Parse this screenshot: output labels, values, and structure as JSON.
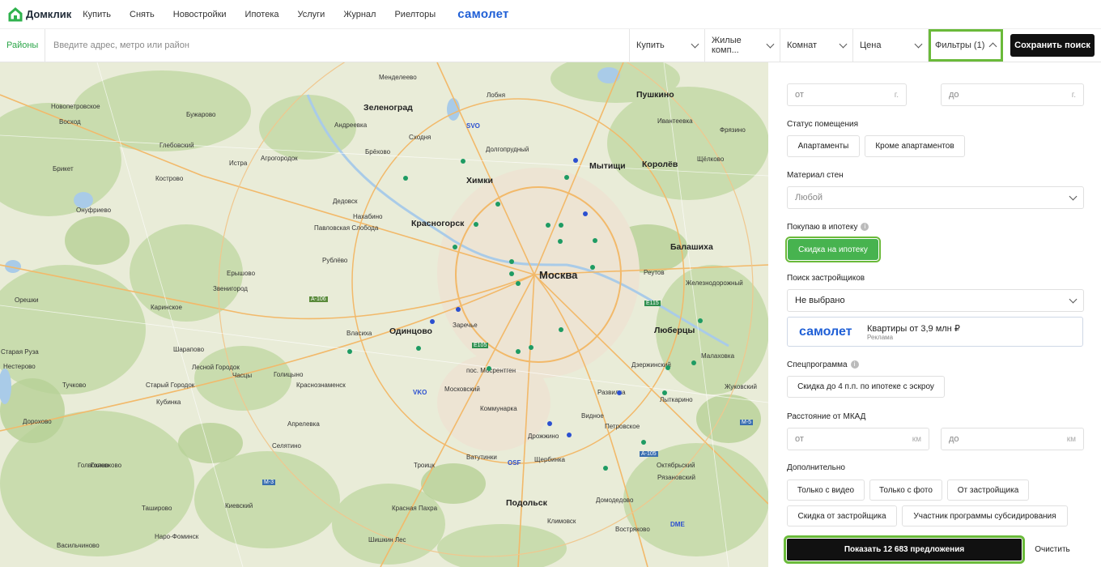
{
  "header": {
    "logo": "Домклик",
    "nav": [
      "Купить",
      "Снять",
      "Новостройки",
      "Ипотека",
      "Услуги",
      "Журнал",
      "Риелторы"
    ],
    "brand": "самолет"
  },
  "search": {
    "districts": "Районы",
    "placeholder": "Введите адрес, метро или район",
    "deal_type": "Купить",
    "property_type": "Жилые комп...",
    "rooms": "Комнат",
    "price": "Цена",
    "filters": "Фильтры (1)",
    "save": "Сохранить поиск"
  },
  "map": {
    "big_labels": [
      "Москва"
    ],
    "city_labels": [
      "Зеленоград",
      "Химки",
      "Мытищи",
      "Королёв",
      "Красногорск",
      "Балашиха",
      "Одинцово",
      "Люберцы",
      "Подольск",
      "Пушкино"
    ],
    "labels": [
      "Менделеево",
      "Лобня",
      "Андреевка",
      "Сходня",
      "Долгопрудный",
      "Ивантеевка",
      "Фрязино",
      "Щёлково",
      "Истра",
      "Дедовск",
      "Нахабино",
      "Павловская Слобода",
      "Новопетровское",
      "Бужарово",
      "Восход",
      "Глебовский",
      "Агрогородок",
      "Брёхово",
      "Брикет",
      "Кострово",
      "Онуфриево",
      "Рублёво",
      "Ерышово",
      "Звенигород",
      "Власиха",
      "Заречье",
      "Реутов",
      "Железнодорожный",
      "Голицыно",
      "Краснознаменск",
      "Кубинка",
      "Тучково",
      "Дорохово",
      "Апрелевка",
      "Селятино",
      "Московский",
      "пос. Мосрентген",
      "Видное",
      "Развилка",
      "Лыткарино",
      "Малаховка",
      "Дзержинский",
      "Петровское",
      "Дрожжино",
      "Щербинка",
      "Троицк",
      "Домодедово",
      "Климовск",
      "Красная Пахра",
      "Востряково",
      "Наро-Фоминск",
      "Киевский",
      "Шишкин Лес",
      "Старая Руза",
      "Нестерово",
      "Шарапово",
      "Лесной Городок",
      "Старый Городок",
      "Часцы",
      "Орешки",
      "Каринское",
      "Голвокино",
      "Ташировo",
      "Васильчиново",
      "Голoвково",
      "Коммунарка",
      "Жуковский",
      "Октябрьский",
      "Ватутинки",
      "Рязановский"
    ],
    "airports": [
      "SVO",
      "VKO",
      "DME",
      "OSF"
    ],
    "road_badges": [
      "A-106",
      "E105",
      "E115",
      "M-5",
      "M-3",
      "A-105"
    ]
  },
  "panel": {
    "year_from": "от",
    "year_to": "до",
    "year_unit": "г.",
    "status_title": "Статус помещения",
    "status_options": [
      "Апартаменты",
      "Кроме апартаментов"
    ],
    "walls_title": "Материал стен",
    "walls_value": "Любой",
    "mortgage_title": "Покупаю в ипотеку",
    "mortgage_option": "Скидка на ипотеку",
    "developer_title": "Поиск застройщиков",
    "developer_value": "Не выбрано",
    "ad_logo": "самолет",
    "ad_text": "Квартиры от 3,9 млн ₽",
    "ad_sub": "Реклама",
    "special_title": "Спецпрограмма",
    "special_option": "Скидка до 4 п.п. по ипотеке с эскроу",
    "mkad_title": "Расстояние от МКАД",
    "mkad_from": "от",
    "mkad_to": "до",
    "mkad_unit": "км",
    "extra_title": "Дополнительно",
    "extra_options": [
      "Только с видео",
      "Только с фото",
      "От застройщика",
      "Скидка от застройщика",
      "Участник программы субсидирования"
    ],
    "show": "Показать 12 683 предложения",
    "clear": "Очистить"
  },
  "colors": {
    "accent_green": "#47b34f",
    "highlight_outline": "#6aba3a",
    "brand_blue": "#1f5fd6",
    "pin_green": "#1e9b63",
    "pin_blue": "#2b4fd0"
  }
}
